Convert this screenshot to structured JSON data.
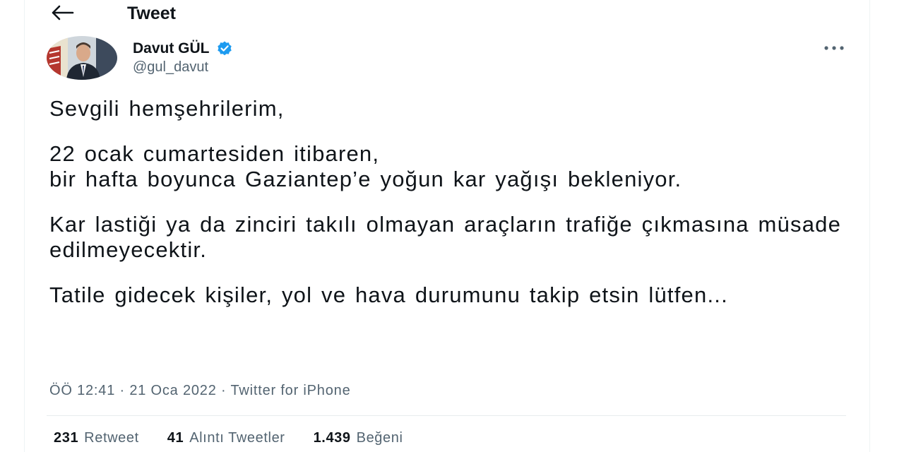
{
  "header": {
    "back_icon": "arrow-left-icon",
    "title": "Tweet"
  },
  "author": {
    "display_name": "Davut GÜL",
    "handle": "@gul_davut",
    "verified": true,
    "verified_color": "#1d9bf0"
  },
  "tweet": {
    "paragraphs": [
      "Sevgili hemşehrilerim,",
      "22 ocak cumartesiden itibaren,\nbir hafta boyunca Gaziantep’e yoğun kar yağışı bekleniyor.",
      "Kar lastiği ya da zinciri takılı olmayan araçların trafiğe çıkmasına müsade edilmeyecektir.",
      "Tatile gidecek kişiler, yol ve hava durumunu takip etsin lütfen..."
    ],
    "time": "ÖÖ 12:41",
    "date": "21 Oca 2022",
    "source": "Twitter for iPhone",
    "separator": " · "
  },
  "stats": {
    "retweets_count": "231",
    "retweets_label": "Retweet",
    "quotes_count": "41",
    "quotes_label": "Alıntı Tweetler",
    "likes_count": "1.439",
    "likes_label": "Beğeni"
  },
  "colors": {
    "text_primary": "#0f1419",
    "text_secondary": "#536471",
    "divider": "#e7ecee"
  }
}
